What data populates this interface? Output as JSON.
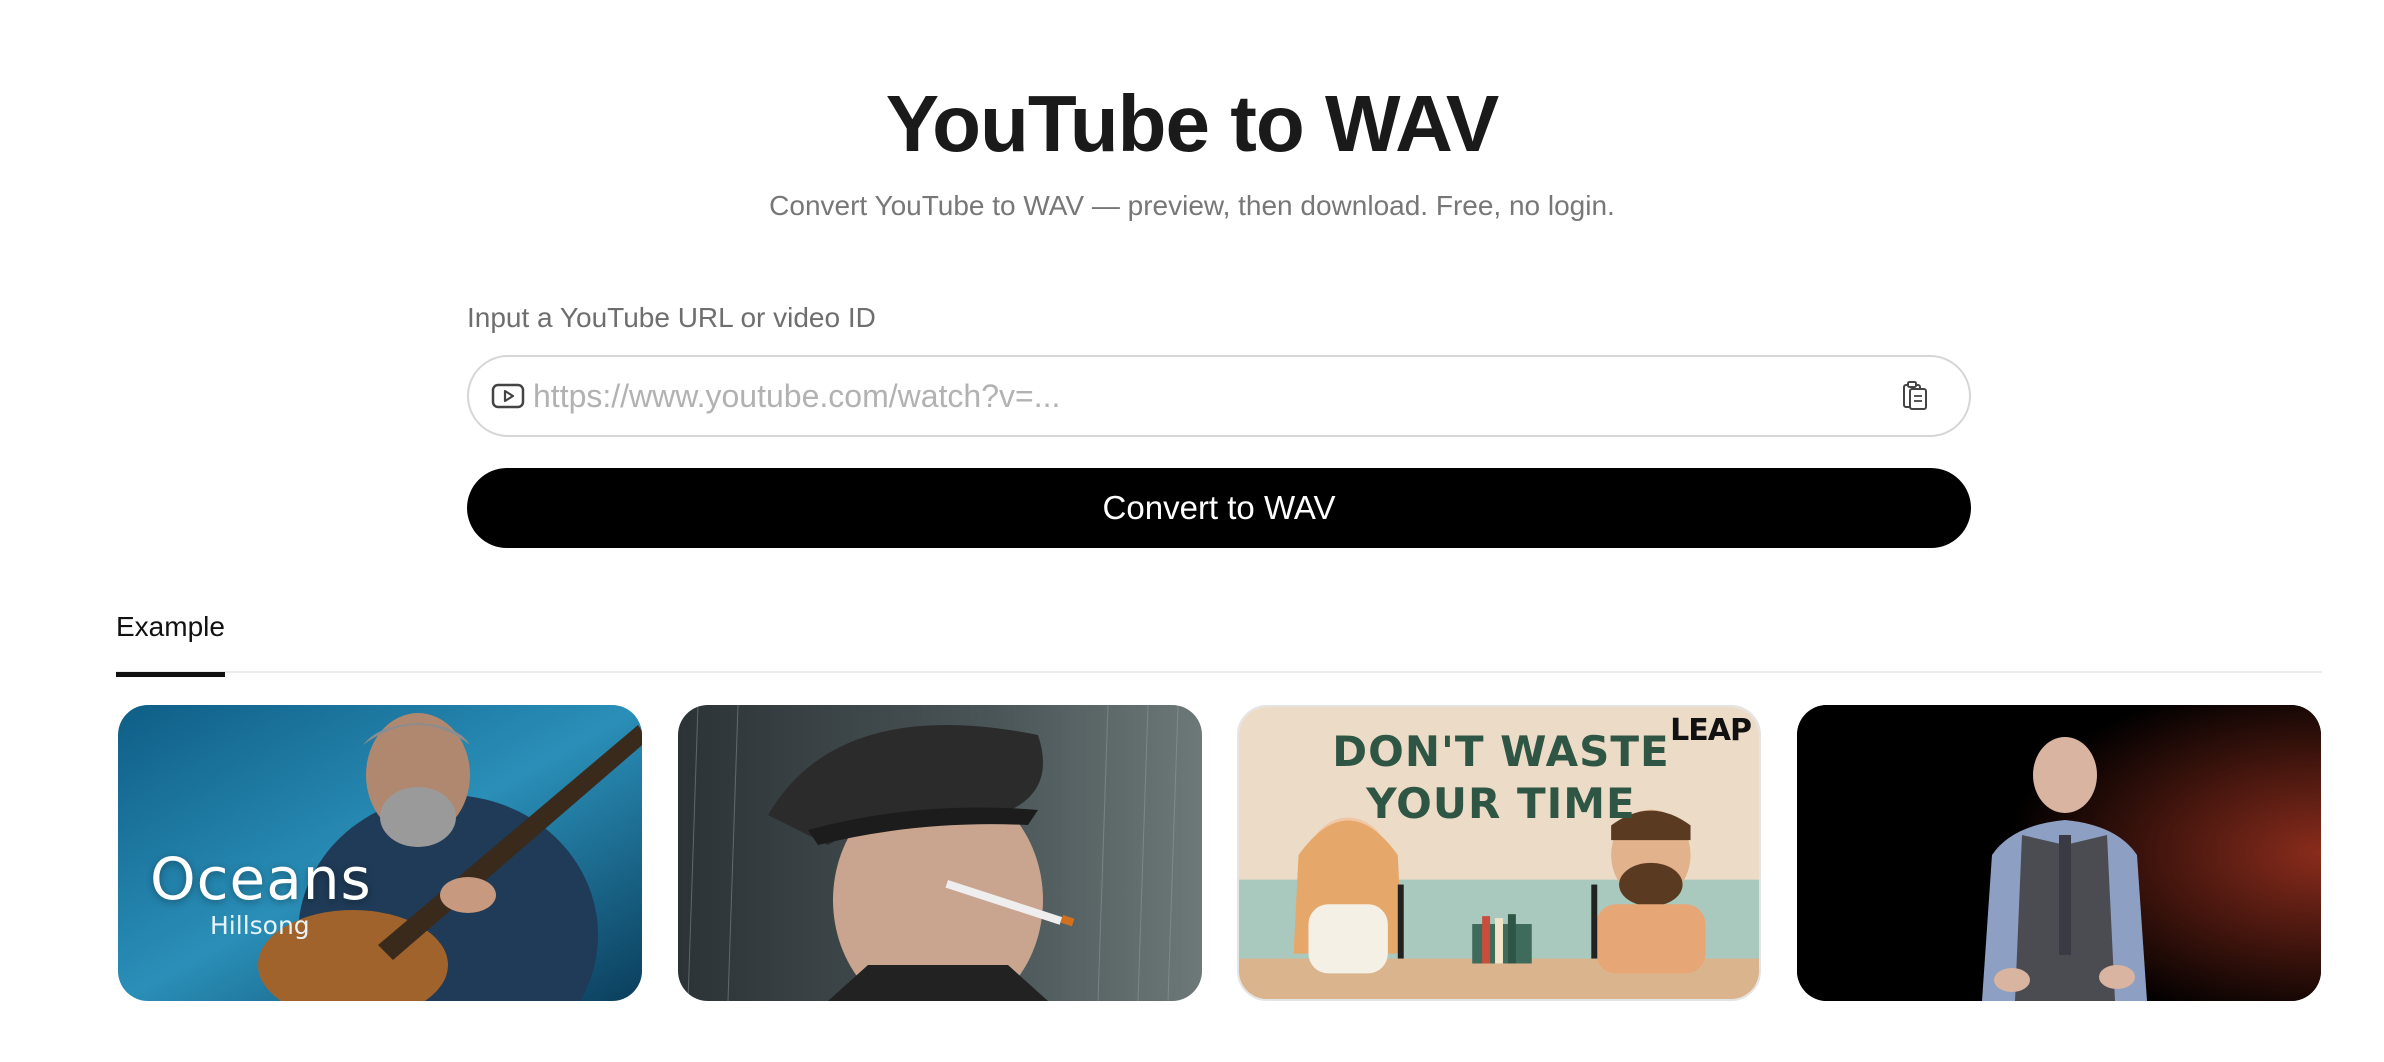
{
  "header": {
    "title": "YouTube to WAV",
    "subtitle": "Convert YouTube to WAV — preview, then download. Free, no login."
  },
  "form": {
    "label": "Input a YouTube URL or video ID",
    "value": "",
    "placeholder": "https://www.youtube.com/watch?v=...",
    "input_icon": "youtube-icon",
    "paste_icon": "clipboard-paste-icon",
    "submit_label": "Convert to WAV"
  },
  "tabs": [
    {
      "label": "Example",
      "active": true
    }
  ],
  "examples": [
    {
      "thumbnail": "man-playing-guitar",
      "overlay_title": "Oceans",
      "overlay_subtitle": "Hillsong"
    },
    {
      "thumbnail": "man-in-cap-smoking-in-rain"
    },
    {
      "thumbnail": "podcast-illustration",
      "poster_line1": "DON'T WASTE",
      "poster_line2": "YOUR TIME",
      "logo": "LEAP"
    },
    {
      "thumbnail": "speaker-on-stage"
    }
  ],
  "colors": {
    "button": "#000000",
    "button_text": "#ffffff",
    "title": "#1a1a1a",
    "muted": "#777777",
    "poster_green": "#2f5644"
  }
}
